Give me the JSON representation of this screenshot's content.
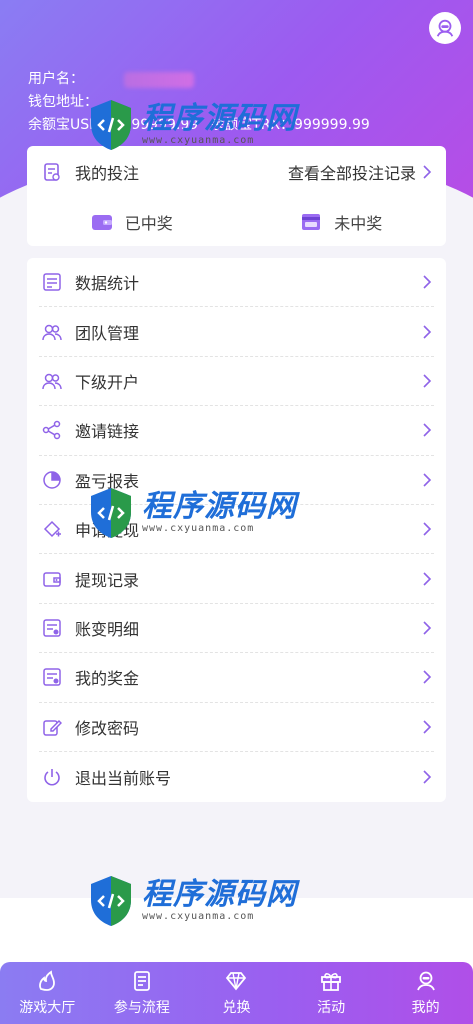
{
  "header": {
    "username_label": "用户名：",
    "wallet_label": "钱包地址：",
    "balance_usdt": "余额宝USDT：999999.99",
    "balance_trx": "余额宝TRX：999999.99"
  },
  "bets": {
    "title": "我的投注",
    "view_all": "查看全部投注记录",
    "won": "已中奖",
    "not_won": "未中奖"
  },
  "menu": [
    {
      "label": "数据统计",
      "icon": "stats-doc-icon"
    },
    {
      "label": "团队管理",
      "icon": "team-icon"
    },
    {
      "label": "下级开户",
      "icon": "sub-account-icon"
    },
    {
      "label": "邀请链接",
      "icon": "share-icon"
    },
    {
      "label": "盈亏报表",
      "icon": "pie-chart-icon"
    },
    {
      "label": "申请提现",
      "icon": "withdraw-apply-icon"
    },
    {
      "label": "提现记录",
      "icon": "wallet-icon"
    },
    {
      "label": "账变明细",
      "icon": "ledger-icon"
    },
    {
      "label": "我的奖金",
      "icon": "bonus-icon"
    },
    {
      "label": "修改密码",
      "icon": "edit-password-icon"
    },
    {
      "label": "退出当前账号",
      "icon": "power-icon"
    }
  ],
  "watermark": {
    "title": "程序源码网",
    "url": "www.cxyuanma.com"
  },
  "nav": [
    {
      "label": "游戏大厅",
      "icon": "game-hall-icon"
    },
    {
      "label": "参与流程",
      "icon": "process-icon"
    },
    {
      "label": "兑换",
      "icon": "diamond-icon"
    },
    {
      "label": "活动",
      "icon": "gift-icon"
    },
    {
      "label": "我的",
      "icon": "profile-icon"
    }
  ],
  "colors": {
    "accent": "#9b6cf2",
    "icon_purple": "#8f63e8",
    "header_start": "#8a7df3",
    "header_end": "#b64de6"
  }
}
